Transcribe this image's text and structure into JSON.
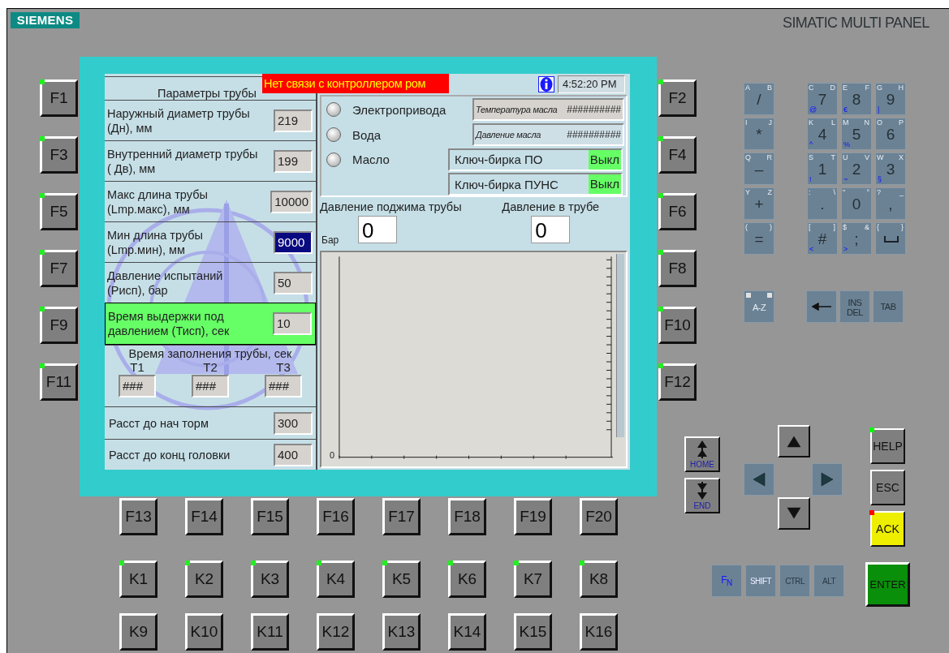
{
  "device": {
    "brand": "SIEMENS",
    "model": "SIMATIC MULTI PANEL"
  },
  "screen": {
    "alarm": "Нет связи с контроллером ром",
    "clock": "4:52:20 PM",
    "parameters": {
      "title": "Параметры трубы",
      "rows": [
        {
          "kind": "field",
          "label": "Наружный диаметр трубы\n (Дн), мм",
          "value": "219",
          "selected": false,
          "highlighted": false
        },
        {
          "kind": "field",
          "label": "Внутренний диаметр трубы\n( Дв), мм",
          "value": "199",
          "selected": false,
          "highlighted": false
        },
        {
          "kind": "field",
          "label": "Макс длина трубы\n (Lmp.макс), мм",
          "value": "10000",
          "selected": false,
          "highlighted": false
        },
        {
          "kind": "field",
          "label": "Мин длина трубы\n (Lmp.мин), мм",
          "value": "9000",
          "selected": true,
          "highlighted": false
        },
        {
          "kind": "field",
          "label": "Давление испытаний\n (Рисп), бар",
          "value": "50",
          "selected": false,
          "highlighted": false
        },
        {
          "kind": "field",
          "label": "Время выдержки под\nдавлением (Тисп), сек",
          "value": "10",
          "selected": false,
          "highlighted": true
        },
        {
          "kind": "group",
          "label": "Время заполнения трубы, сек",
          "fields": [
            {
              "label": "T1",
              "value": "###"
            },
            {
              "label": "T2",
              "value": "###"
            },
            {
              "label": "T3",
              "value": "###"
            }
          ]
        },
        {
          "kind": "field",
          "label": "Расст до нач торм",
          "value": "300",
          "selected": false,
          "highlighted": false
        },
        {
          "kind": "field",
          "label": "Расст до конц головки",
          "value": "400",
          "selected": false,
          "highlighted": false
        }
      ]
    },
    "lamps": [
      {
        "label": "Электропривода",
        "on": false
      },
      {
        "label": "Вода",
        "on": false
      },
      {
        "label": "Масло",
        "on": false
      }
    ],
    "readouts": [
      {
        "label": "Температура масла",
        "value": "##########"
      },
      {
        "label": "Давление масла",
        "value": "##########"
      }
    ],
    "key_tags": [
      {
        "label": "Ключ-бирка ПО",
        "state": "Выкл"
      },
      {
        "label": "Ключ-бирка ПУНС",
        "state": "Выкл"
      }
    ],
    "pressures": [
      {
        "label": "Давление поджима трубы",
        "value": "0",
        "unit": "Бар"
      },
      {
        "label": "Давление в трубе",
        "value": "0"
      }
    ],
    "trend": {
      "axis_label": "0"
    }
  },
  "function_keys": {
    "left": [
      {
        "label": "F1",
        "led": true
      },
      {
        "label": "F3",
        "led": true
      },
      {
        "label": "F5",
        "led": true
      },
      {
        "label": "F7",
        "led": true
      },
      {
        "label": "F9",
        "led": true
      },
      {
        "label": "F11",
        "led": true
      }
    ],
    "right": [
      {
        "label": "F2",
        "led": true
      },
      {
        "label": "F4",
        "led": true
      },
      {
        "label": "F6",
        "led": true
      },
      {
        "label": "F8",
        "led": true
      },
      {
        "label": "F10",
        "led": true
      },
      {
        "label": "F12",
        "led": true
      }
    ],
    "bottom": [
      {
        "label": "F13",
        "led": false
      },
      {
        "label": "F14",
        "led": false
      },
      {
        "label": "F15",
        "led": false
      },
      {
        "label": "F16",
        "led": false
      },
      {
        "label": "F17",
        "led": false
      },
      {
        "label": "F18",
        "led": false
      },
      {
        "label": "F19",
        "led": false
      },
      {
        "label": "F20",
        "led": false
      }
    ]
  },
  "soft_keys": [
    [
      {
        "label": "K1",
        "led": true
      },
      {
        "label": "K2",
        "led": true
      },
      {
        "label": "K3",
        "led": true
      },
      {
        "label": "K4",
        "led": true
      },
      {
        "label": "K5",
        "led": true
      },
      {
        "label": "K6",
        "led": true
      },
      {
        "label": "K7",
        "led": true
      },
      {
        "label": "K8",
        "led": true
      }
    ],
    [
      {
        "label": "K9",
        "led": false
      },
      {
        "label": "K10",
        "led": false
      },
      {
        "label": "K11",
        "led": false
      },
      {
        "label": "K12",
        "led": false
      },
      {
        "label": "K13",
        "led": false
      },
      {
        "label": "K14",
        "led": false
      },
      {
        "label": "K15",
        "led": false
      },
      {
        "label": "K16",
        "led": false
      }
    ]
  ],
  "keypad": {
    "letter_keys": [
      {
        "label": "/",
        "upper_left": "A",
        "upper_right": "B"
      },
      {
        "label": "*",
        "upper_left": "I",
        "upper_right": "J"
      },
      {
        "label": "–",
        "upper_left": "Q",
        "upper_right": "R"
      },
      {
        "label": "+",
        "upper_left": "Y",
        "upper_right": "Z"
      },
      {
        "label": "=",
        "upper_left": "(",
        "upper_right": ")"
      }
    ],
    "number_keys": [
      {
        "kind": "char",
        "label": "7",
        "upper_left": "C",
        "upper_right": "D",
        "lower": "@"
      },
      {
        "kind": "char",
        "label": "8",
        "upper_left": "E",
        "upper_right": "F",
        "lower": "€"
      },
      {
        "kind": "char",
        "label": "9",
        "upper_left": "G",
        "upper_right": "H",
        "lower": "|"
      },
      {
        "kind": "char",
        "label": "4",
        "upper_left": "K",
        "upper_right": "L",
        "lower": "^"
      },
      {
        "kind": "char",
        "label": "5",
        "upper_left": "M",
        "upper_right": "N",
        "lower": "%"
      },
      {
        "kind": "char",
        "label": "6",
        "upper_left": "O",
        "upper_right": "P"
      },
      {
        "kind": "char",
        "label": "1",
        "upper_left": "S",
        "upper_right": "T",
        "lower": "!"
      },
      {
        "kind": "char",
        "label": "2",
        "upper_left": "U",
        "upper_right": "V",
        "lower": "~"
      },
      {
        "kind": "char",
        "label": "3",
        "upper_left": "W",
        "upper_right": "X",
        "lower": "§"
      },
      {
        "kind": "char",
        "label": ".",
        "upper_left": ":",
        "upper_right": "\\"
      },
      {
        "kind": "char",
        "label": "0",
        "upper_left": "\"",
        "upper_right": "°"
      },
      {
        "kind": "char",
        "label": ",",
        "upper_left": "?",
        "upper_right": "_"
      },
      {
        "kind": "char",
        "label": "#",
        "upper_left": "[",
        "upper_right": "]",
        "lower": "<"
      },
      {
        "kind": "char",
        "label": ";",
        "upper_left": "$",
        "upper_right": "&",
        "lower": ">"
      },
      {
        "kind": "space",
        "upper_left": "{",
        "upper_right": "}"
      }
    ],
    "edit_keys": [
      {
        "kind": "case",
        "label": "A-Z"
      },
      {
        "kind": "backspace"
      },
      {
        "kind": "stack",
        "label": "INS",
        "sub_label": "DEL"
      },
      {
        "kind": "text",
        "label": "TAB"
      }
    ]
  },
  "navigation": {
    "home": "HOME",
    "end": "END",
    "arrows": [
      {
        "kind": "up"
      },
      {
        "kind": "left"
      },
      {
        "kind": "right"
      },
      {
        "kind": "down"
      }
    ]
  },
  "side_keys": [
    {
      "label": "HELP",
      "kind": "plain",
      "color": "#00ff00"
    },
    {
      "label": "ESC",
      "kind": "plain"
    },
    {
      "label": "ACK",
      "kind": "alert",
      "color": "#ff0000"
    }
  ],
  "modifiers": [
    {
      "label": "F$_{N}$",
      "kind": "fn"
    },
    {
      "label": "SHIFT",
      "kind": "shift"
    },
    {
      "label": "CTRL",
      "kind": "plain"
    },
    {
      "label": "ALT",
      "kind": "plain"
    }
  ],
  "enter": {
    "label": "ENTER",
    "kind": "confirm"
  }
}
